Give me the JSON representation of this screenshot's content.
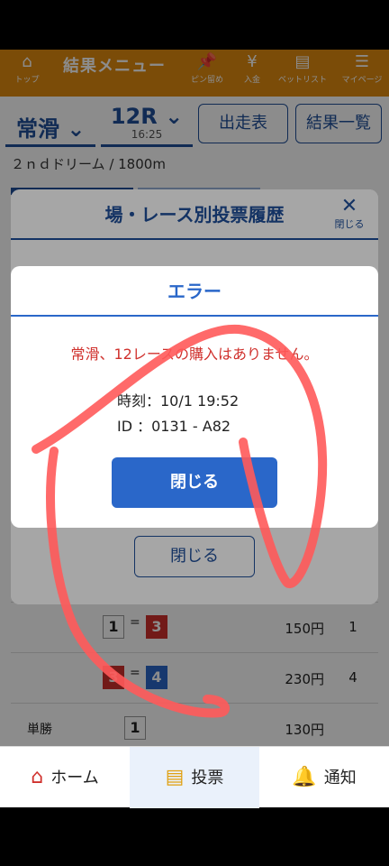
{
  "topbar": {
    "title": "結果メニュー",
    "items": [
      {
        "label": "トップ",
        "icon": "home-icon"
      },
      {
        "label": "ピン留め",
        "icon": "pin-icon"
      },
      {
        "label": "入金",
        "icon": "deposit-icon"
      },
      {
        "label": "ベットリスト",
        "icon": "betlist-icon"
      },
      {
        "label": "マイページ",
        "icon": "menu-icon"
      }
    ]
  },
  "selector": {
    "venue": "常滑",
    "race": "12R",
    "race_time": "16:25",
    "entry_button": "出走表",
    "results_button": "結果一覧"
  },
  "course": "２ｎｄドリーム / 1800m",
  "results_table": [
    {
      "label": "",
      "nums": [
        "1",
        "3"
      ],
      "price": "150円",
      "popularity": "1"
    },
    {
      "label": "",
      "nums": [
        "3",
        "4"
      ],
      "price": "230円",
      "popularity": "4"
    },
    {
      "label": "単勝",
      "nums": [
        "1"
      ],
      "price": "130円",
      "popularity": ""
    }
  ],
  "history_modal": {
    "title": "場・レース別投票履歴",
    "close_icon_label": "閉じる",
    "close_button": "閉じる"
  },
  "error_modal": {
    "title": "エラー",
    "message": "常滑、12レースの購入はありません。",
    "time_line": "時刻：10/1 19:52",
    "id_line": "ID ：0131 - A82",
    "close_button": "閉じる"
  },
  "bottom_nav": [
    {
      "label": "ホーム",
      "icon": "house-icon"
    },
    {
      "label": "投票",
      "icon": "ticket-icon"
    },
    {
      "label": "通知",
      "icon": "bell-icon"
    }
  ],
  "colors": {
    "topbar": "#e08a10",
    "primary": "#2a67c9",
    "error": "#d0312d",
    "scribble": "#ff5a5a"
  }
}
